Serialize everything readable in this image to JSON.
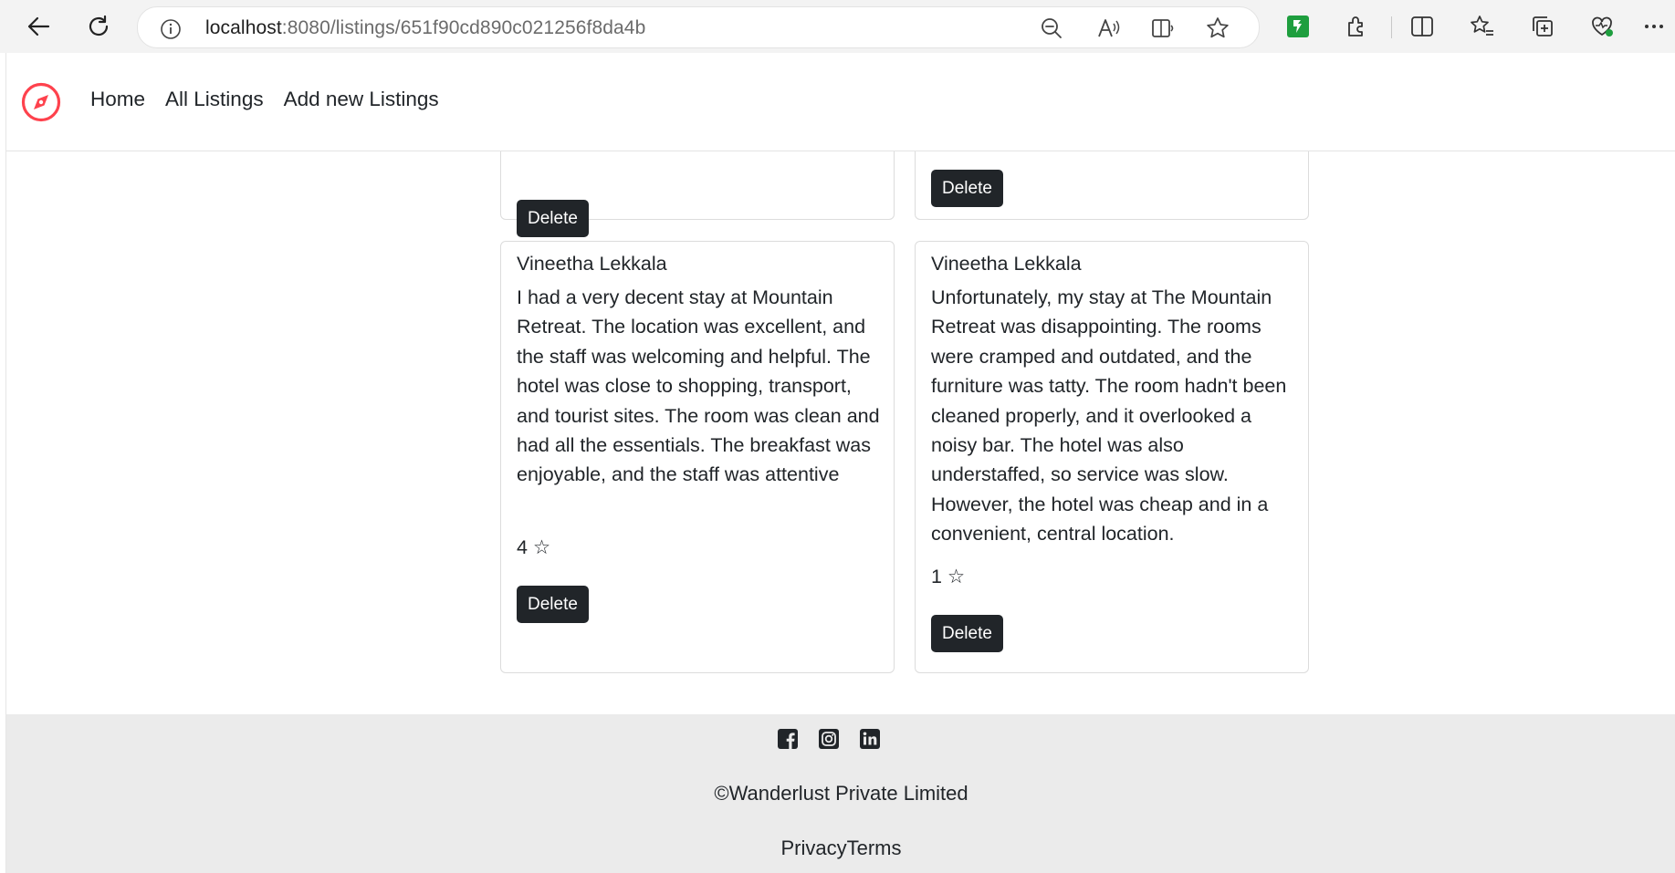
{
  "browser": {
    "url_host": "localhost",
    "url_path": ":8080/listings/651f90cd890c021256f8da4b"
  },
  "nav": {
    "links": [
      "Home",
      "All Listings",
      "Add new Listings"
    ]
  },
  "top_cards": [
    {
      "delete_label": "Delete"
    },
    {
      "delete_label": "Delete"
    }
  ],
  "reviews": [
    {
      "author": "Vineetha Lekkala",
      "comment": "I had a very decent stay at Mountain Retreat. The location was excellent, and the staff was welcoming and helpful. The hotel was close to shopping, transport, and tourist sites. The room was clean and had all the essentials. The breakfast was enjoyable, and the staff was attentive",
      "rating": "4 ☆",
      "delete_label": "Delete"
    },
    {
      "author": "Vineetha Lekkala",
      "comment": "Unfortunately, my stay at The Mountain Retreat was disappointing. The rooms were cramped and outdated, and the furniture was tatty. The room hadn't been cleaned properly, and it overlooked a noisy bar. The hotel was also understaffed, so service was slow. However, the hotel was cheap and in a convenient, central location.",
      "rating": "1 ☆",
      "delete_label": "Delete"
    }
  ],
  "footer": {
    "socials": [
      "facebook-icon",
      "instagram-icon",
      "linkedin-icon"
    ],
    "copyright": "©Wanderlust Private Limited",
    "privacy": "Privacy",
    "terms": "Terms"
  },
  "colors": {
    "brand": "#fe424d",
    "button": "#212529",
    "footer_bg": "#ebebeb"
  }
}
